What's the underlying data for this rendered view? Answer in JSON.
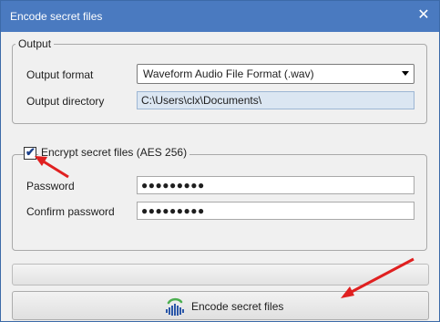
{
  "window": {
    "title": "Encode secret files",
    "close_glyph": "✕"
  },
  "output": {
    "legend": "Output",
    "format_label": "Output format",
    "format_value": "Waveform Audio File Format (.wav)",
    "directory_label": "Output directory",
    "directory_value": "C:\\Users\\clx\\Documents\\"
  },
  "encryption": {
    "legend": "Encrypt secret files (AES 256)",
    "checked": true,
    "check_glyph": "✔",
    "password_label": "Password",
    "password_value": "●●●●●●●●●",
    "confirm_label": "Confirm password",
    "confirm_value": "●●●●●●●●●"
  },
  "progress": {
    "value": 0
  },
  "actions": {
    "encode_label": "Encode secret files",
    "encode_icon": "audio-wave-icon"
  },
  "colors": {
    "titlebar": "#4a7ac0",
    "annotation_arrow": "#e02020"
  }
}
